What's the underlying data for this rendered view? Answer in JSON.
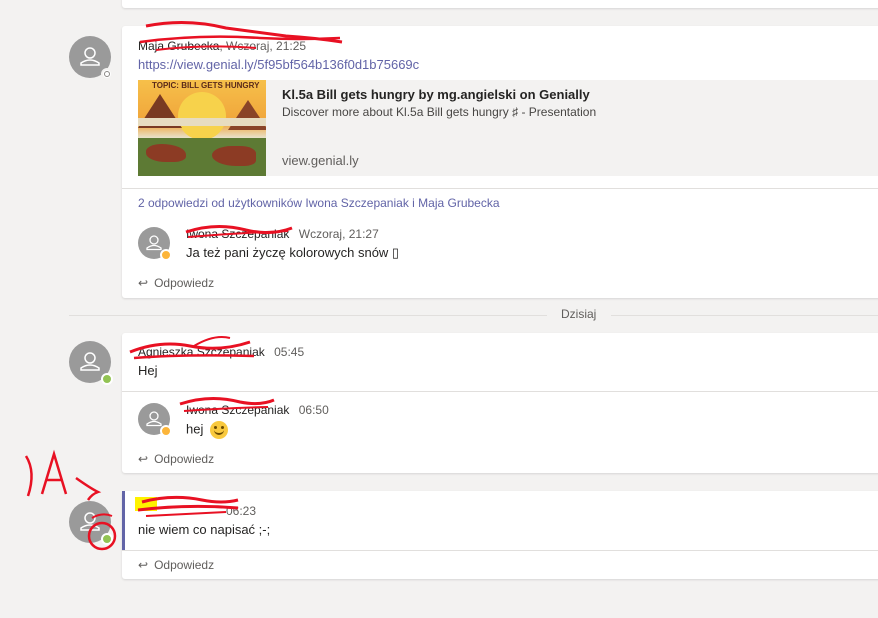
{
  "top_divider": {},
  "message1": {
    "author": "Maja Grubecka",
    "time": "Wczoraj, 21:25",
    "link": "https://view.genial.ly/5f95bf564b136f0d1b75669c",
    "preview": {
      "thumb_text": "TOPIC: BILL GETS HUNGRY",
      "title": "Kl.5a Bill gets hungry by mg.angielski on Genially",
      "description": "Discover more about Kl.5a Bill gets hungry ♯ - Presentation",
      "domain": "view.genial.ly"
    },
    "replies_summary": "2 odpowiedzi od użytkowników Iwona Szczepaniak i Maja Grubecka",
    "reply": {
      "author": "Iwona Szczepaniak",
      "time": "Wczoraj, 21:27",
      "text": "Ja też pani życzę kolorowych snów ▯"
    },
    "reply_label": "Odpowiedz"
  },
  "day_divider": {
    "label": "Dzisiaj"
  },
  "message2": {
    "author": "Agnieszka Szczepaniak",
    "time": "05:45",
    "text": "Hej",
    "reply": {
      "author": "Iwona Szczepaniak",
      "time": "06:50",
      "text": "hej"
    },
    "reply_label": "Odpowiedz"
  },
  "message3": {
    "author": "",
    "time": "06:23",
    "text": "nie wiem co napisać ;-;",
    "reply_label": "Odpowiedz",
    "annotation": ")A)"
  },
  "colors": {
    "link": "#6264a7",
    "available": "#92c353",
    "away": "#fcb53a",
    "annotation_red": "#e81123",
    "highlight": "#fff200"
  }
}
